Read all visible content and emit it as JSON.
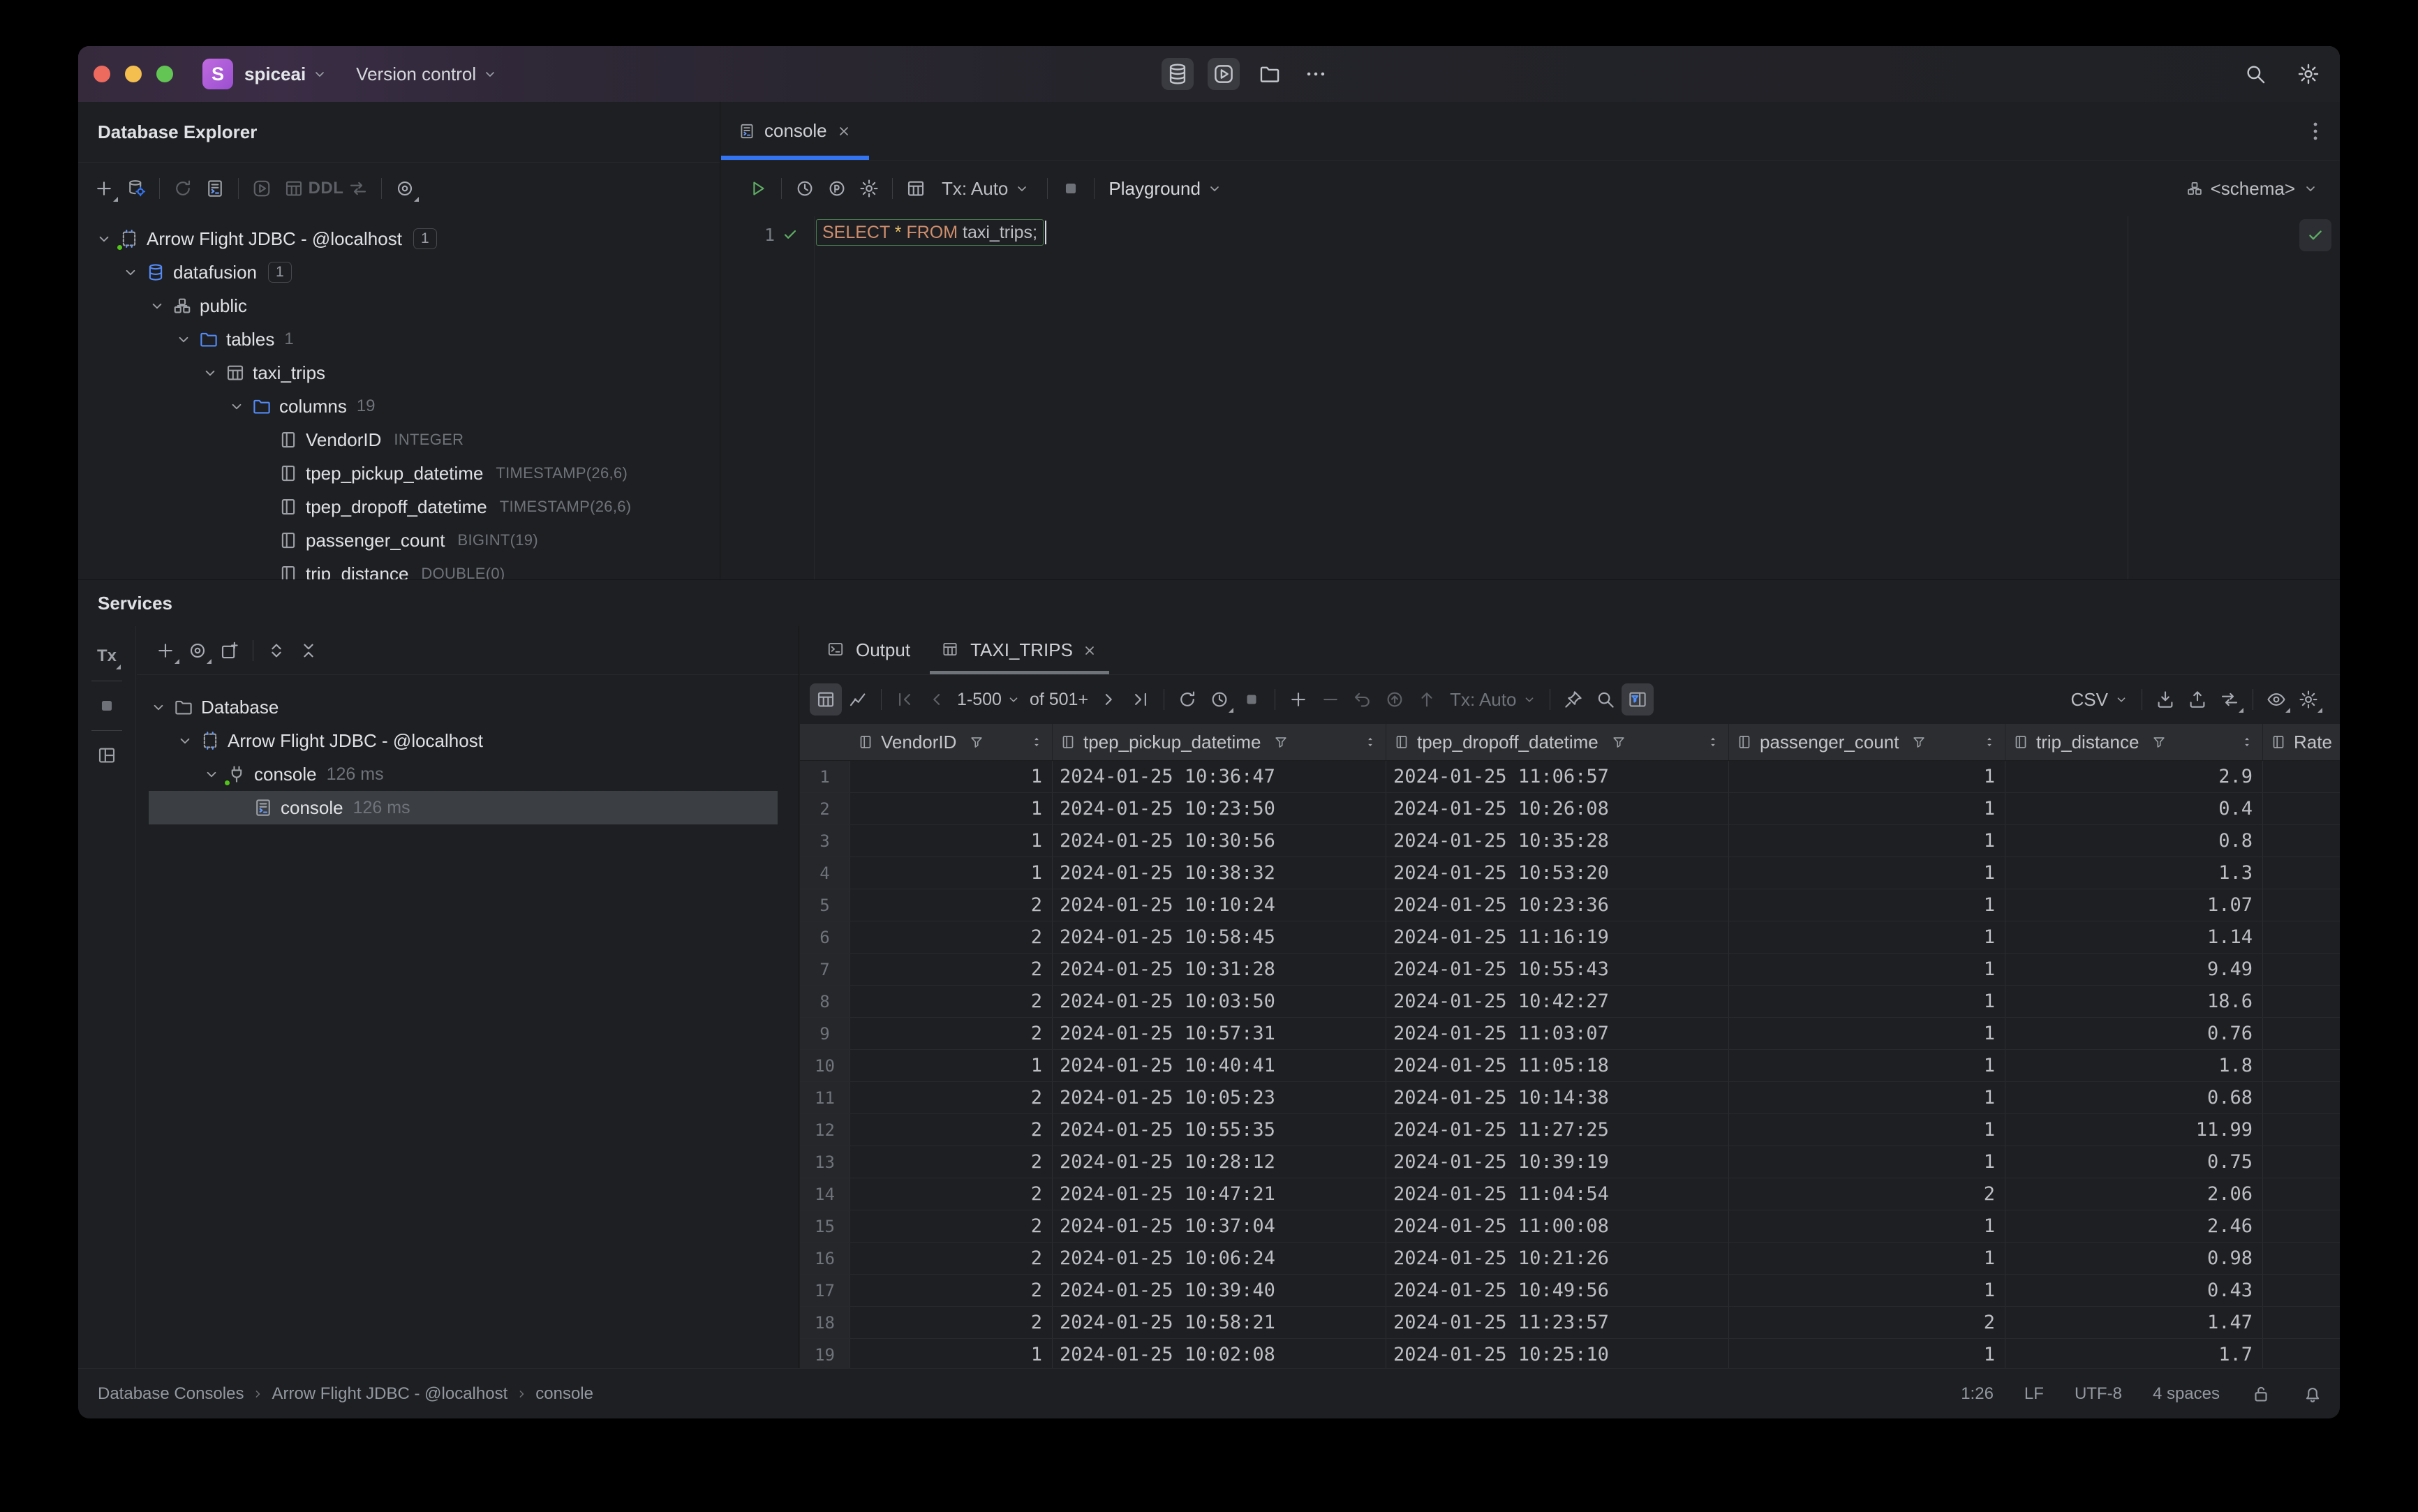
{
  "titlebar": {
    "logo_letter": "S",
    "project_name": "spiceai",
    "menu_label": "Version control"
  },
  "database_explorer": {
    "title": "Database Explorer",
    "ddl_label": "DDL",
    "tree": [
      {
        "indent": 0,
        "chevron": true,
        "icon": "datasource",
        "dot": true,
        "label": "Arrow Flight JDBC - @localhost",
        "count": "1",
        "boxed": true
      },
      {
        "indent": 1,
        "chevron": true,
        "icon": "database",
        "label": "datafusion",
        "count": "1",
        "boxed": true
      },
      {
        "indent": 2,
        "chevron": true,
        "icon": "schema",
        "label": "public"
      },
      {
        "indent": 3,
        "chevron": true,
        "icon": "folder",
        "label": "tables",
        "count": "1"
      },
      {
        "indent": 4,
        "chevron": true,
        "icon": "table",
        "label": "taxi_trips"
      },
      {
        "indent": 5,
        "chevron": true,
        "icon": "folder",
        "label": "columns",
        "count": "19"
      },
      {
        "indent": 6,
        "chevron": false,
        "icon": "column",
        "label": "VendorID",
        "datatype": "INTEGER"
      },
      {
        "indent": 6,
        "chevron": false,
        "icon": "column",
        "label": "tpep_pickup_datetime",
        "datatype": "TIMESTAMP(26,6)"
      },
      {
        "indent": 6,
        "chevron": false,
        "icon": "column",
        "label": "tpep_dropoff_datetime",
        "datatype": "TIMESTAMP(26,6)"
      },
      {
        "indent": 6,
        "chevron": false,
        "icon": "column",
        "label": "passenger_count",
        "datatype": "BIGINT(19)"
      },
      {
        "indent": 6,
        "chevron": false,
        "icon": "column",
        "label": "trip_distance",
        "datatype": "DOUBLE(0)"
      }
    ]
  },
  "editor": {
    "tab_label": "console",
    "tx_label": "Tx: Auto",
    "playground_label": "Playground",
    "schema_label": "<schema>",
    "line_number": "1",
    "sql_tokens": [
      {
        "text": "SELECT",
        "type": "keyword"
      },
      {
        "text": " ",
        "type": "plain"
      },
      {
        "text": "*",
        "type": "star"
      },
      {
        "text": " ",
        "type": "plain"
      },
      {
        "text": "FROM",
        "type": "keyword"
      },
      {
        "text": " ",
        "type": "plain"
      },
      {
        "text": "taxi_trips",
        "type": "identifier"
      },
      {
        "text": ";",
        "type": "plain"
      }
    ]
  },
  "services": {
    "title": "Services",
    "tx_strip_label": "Tx",
    "tree": [
      {
        "indent": 0,
        "chevron": true,
        "icon": "folder-grey",
        "label": "Database"
      },
      {
        "indent": 1,
        "chevron": true,
        "icon": "datasource",
        "label": "Arrow Flight JDBC - @localhost"
      },
      {
        "indent": 2,
        "chevron": true,
        "icon": "plug",
        "dot": true,
        "label": "console",
        "time": "126 ms"
      },
      {
        "indent": 3,
        "chevron": false,
        "icon": "console-file",
        "label": "console",
        "time": "126 ms",
        "selected": true
      }
    ],
    "tabs": [
      {
        "label": "Output",
        "icon": "terminal",
        "active": false,
        "closable": false
      },
      {
        "label": "TAXI_TRIPS",
        "icon": "table",
        "active": true,
        "closable": true
      }
    ]
  },
  "results": {
    "page_range": "1-500",
    "page_of": "of 501+",
    "tx_label": "Tx: Auto",
    "export_label": "CSV",
    "columns": [
      {
        "name": "VendorID",
        "align": "right"
      },
      {
        "name": "tpep_pickup_datetime",
        "align": "left"
      },
      {
        "name": "tpep_dropoff_datetime",
        "align": "left"
      },
      {
        "name": "passenger_count",
        "align": "right"
      },
      {
        "name": "trip_distance",
        "align": "right"
      },
      {
        "name": "Rate",
        "align": "left",
        "clipped": true
      }
    ],
    "rows": [
      [
        "1",
        "2024-01-25 10:36:47",
        "2024-01-25 11:06:57",
        "1",
        "2.9"
      ],
      [
        "1",
        "2024-01-25 10:23:50",
        "2024-01-25 10:26:08",
        "1",
        "0.4"
      ],
      [
        "1",
        "2024-01-25 10:30:56",
        "2024-01-25 10:35:28",
        "1",
        "0.8"
      ],
      [
        "1",
        "2024-01-25 10:38:32",
        "2024-01-25 10:53:20",
        "1",
        "1.3"
      ],
      [
        "2",
        "2024-01-25 10:10:24",
        "2024-01-25 10:23:36",
        "1",
        "1.07"
      ],
      [
        "2",
        "2024-01-25 10:58:45",
        "2024-01-25 11:16:19",
        "1",
        "1.14"
      ],
      [
        "2",
        "2024-01-25 10:31:28",
        "2024-01-25 10:55:43",
        "1",
        "9.49"
      ],
      [
        "2",
        "2024-01-25 10:03:50",
        "2024-01-25 10:42:27",
        "1",
        "18.6"
      ],
      [
        "2",
        "2024-01-25 10:57:31",
        "2024-01-25 11:03:07",
        "1",
        "0.76"
      ],
      [
        "1",
        "2024-01-25 10:40:41",
        "2024-01-25 11:05:18",
        "1",
        "1.8"
      ],
      [
        "2",
        "2024-01-25 10:05:23",
        "2024-01-25 10:14:38",
        "1",
        "0.68"
      ],
      [
        "2",
        "2024-01-25 10:55:35",
        "2024-01-25 11:27:25",
        "1",
        "11.99"
      ],
      [
        "2",
        "2024-01-25 10:28:12",
        "2024-01-25 10:39:19",
        "1",
        "0.75"
      ],
      [
        "2",
        "2024-01-25 10:47:21",
        "2024-01-25 11:04:54",
        "2",
        "2.06"
      ],
      [
        "2",
        "2024-01-25 10:37:04",
        "2024-01-25 11:00:08",
        "1",
        "2.46"
      ],
      [
        "2",
        "2024-01-25 10:06:24",
        "2024-01-25 10:21:26",
        "1",
        "0.98"
      ],
      [
        "2",
        "2024-01-25 10:39:40",
        "2024-01-25 10:49:56",
        "1",
        "0.43"
      ],
      [
        "2",
        "2024-01-25 10:58:21",
        "2024-01-25 11:23:57",
        "2",
        "1.47"
      ],
      [
        "1",
        "2024-01-25 10:02:08",
        "2024-01-25 10:25:10",
        "1",
        "1.7"
      ]
    ]
  },
  "statusbar": {
    "breadcrumbs": [
      "Database Consoles",
      "Arrow Flight JDBC - @localhost",
      "console"
    ],
    "caret_position": "1:26",
    "line_separator": "LF",
    "encoding": "UTF-8",
    "indent_style": "4 spaces"
  },
  "colors": {
    "accent": "#3574f0",
    "green": "#57965c",
    "keyword": "#cf8e6d",
    "selection": "#3b3e42"
  }
}
